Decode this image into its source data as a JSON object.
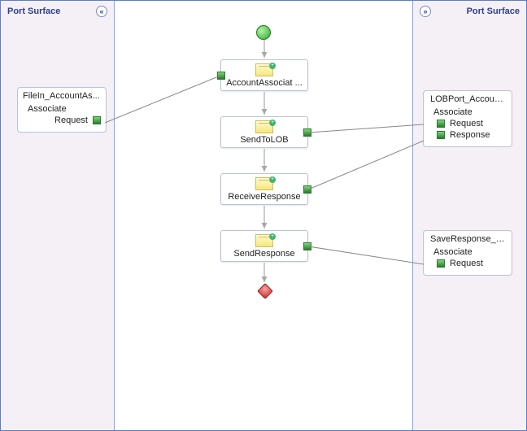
{
  "left_surface": {
    "title": "Port Surface"
  },
  "right_surface": {
    "title": "Port Surface"
  },
  "ports": {
    "filein": {
      "title": "FileIn_AccountAs...",
      "operation": "Associate",
      "msg1": "Request"
    },
    "lob": {
      "title": "LOBPort_Account...",
      "operation": "Associate",
      "msg1": "Request",
      "msg2": "Response"
    },
    "save": {
      "title": "SaveResponse_A...",
      "operation": "Associate",
      "msg1": "Request"
    }
  },
  "shapes": {
    "s1": "AccountAssociat ...",
    "s2": "SendToLOB",
    "s3": "ReceiveResponse",
    "s4": "SendResponse"
  },
  "chart_data": {
    "type": "diagram",
    "tool": "BizTalk Orchestration Designer",
    "title": "",
    "ports_left": [
      {
        "name": "FileIn_AccountAs...",
        "operation": "Associate",
        "messages": [
          "Request"
        ],
        "direction": "receive"
      }
    ],
    "ports_right": [
      {
        "name": "LOBPort_Account...",
        "operation": "Associate",
        "messages": [
          "Request",
          "Response"
        ],
        "direction": "send-receive"
      },
      {
        "name": "SaveResponse_A...",
        "operation": "Associate",
        "messages": [
          "Request"
        ],
        "direction": "send"
      }
    ],
    "shapes": [
      {
        "id": "start",
        "type": "start"
      },
      {
        "id": "AccountAssociat",
        "type": "receive",
        "label": "AccountAssociat ..."
      },
      {
        "id": "SendToLOB",
        "type": "send",
        "label": "SendToLOB"
      },
      {
        "id": "ReceiveResponse",
        "type": "receive",
        "label": "ReceiveResponse"
      },
      {
        "id": "SendResponse",
        "type": "send",
        "label": "SendResponse"
      },
      {
        "id": "end",
        "type": "end"
      }
    ],
    "flow_edges": [
      [
        "start",
        "AccountAssociat"
      ],
      [
        "AccountAssociat",
        "SendToLOB"
      ],
      [
        "SendToLOB",
        "ReceiveResponse"
      ],
      [
        "ReceiveResponse",
        "SendResponse"
      ],
      [
        "SendResponse",
        "end"
      ]
    ],
    "port_bindings": [
      {
        "port": "FileIn_AccountAs...",
        "message": "Request",
        "shape": "AccountAssociat",
        "side": "left"
      },
      {
        "port": "LOBPort_Account...",
        "message": "Request",
        "shape": "SendToLOB",
        "side": "right"
      },
      {
        "port": "LOBPort_Account...",
        "message": "Response",
        "shape": "ReceiveResponse",
        "side": "right"
      },
      {
        "port": "SaveResponse_A...",
        "message": "Request",
        "shape": "SendResponse",
        "side": "right"
      }
    ]
  }
}
